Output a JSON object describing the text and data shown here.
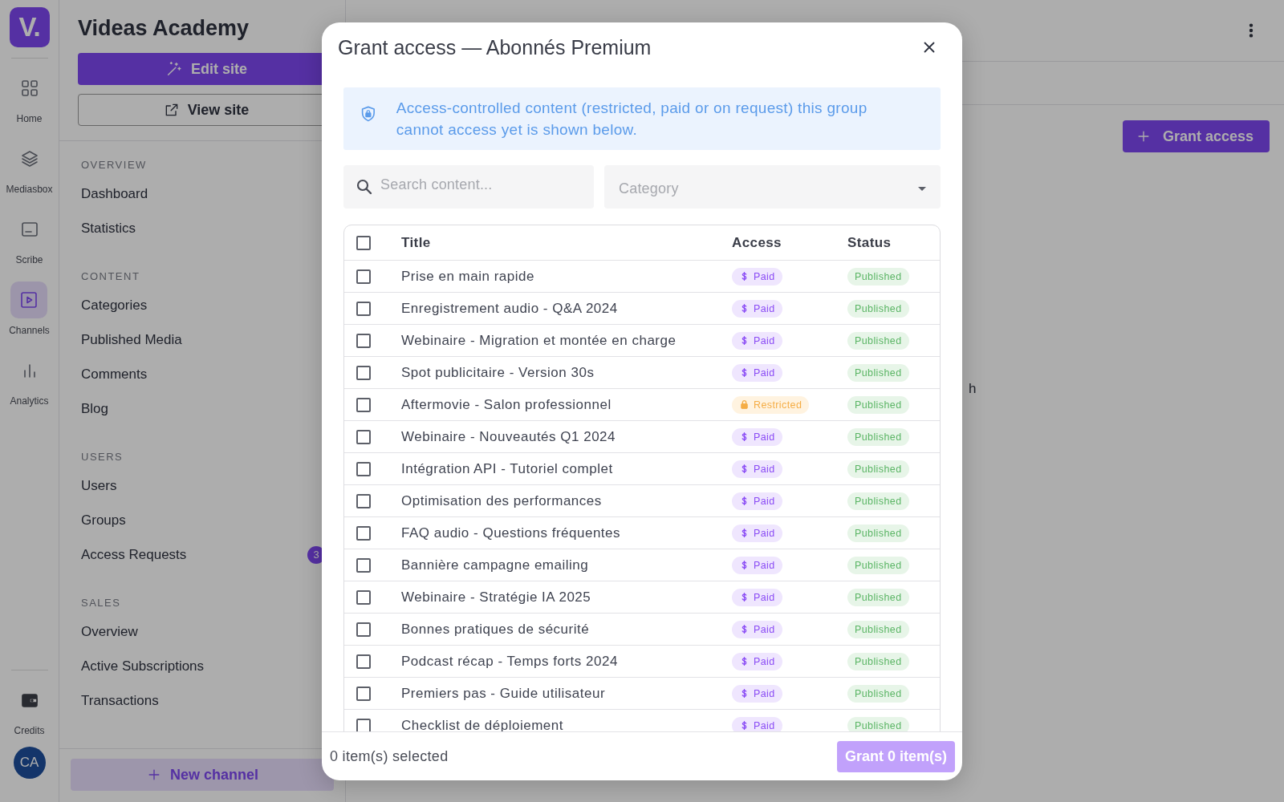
{
  "rail": {
    "logo": "V.",
    "items": [
      {
        "label": "Home",
        "selected": false
      },
      {
        "label": "Mediasbox",
        "selected": false
      },
      {
        "label": "Scribe",
        "selected": false
      },
      {
        "label": "Channels",
        "selected": true
      },
      {
        "label": "Analytics",
        "selected": false
      }
    ],
    "bottom_items": [
      {
        "label": "Credits",
        "selected": false
      }
    ],
    "avatar": "CA"
  },
  "sidebar": {
    "title": "Videas Academy",
    "edit_button": "Edit site",
    "view_button": "View site",
    "sections": [
      {
        "heading": "OVERVIEW",
        "items": [
          {
            "label": "Dashboard"
          },
          {
            "label": "Statistics"
          }
        ]
      },
      {
        "heading": "CONTENT",
        "items": [
          {
            "label": "Categories"
          },
          {
            "label": "Published Media"
          },
          {
            "label": "Comments"
          },
          {
            "label": "Blog"
          }
        ]
      },
      {
        "heading": "USERS",
        "items": [
          {
            "label": "Users"
          },
          {
            "label": "Groups"
          },
          {
            "label": "Access Requests",
            "badge": "3"
          }
        ]
      },
      {
        "heading": "SALES",
        "items": [
          {
            "label": "Overview"
          },
          {
            "label": "Active Subscriptions"
          },
          {
            "label": "Transactions"
          }
        ]
      }
    ],
    "new_channel": "New channel"
  },
  "main": {
    "fragment": "h",
    "grant_button": "Grant access"
  },
  "modal": {
    "title": "Grant access — Abonnés Premium",
    "notice": "Access-controlled content (restricted, paid or on request) this group cannot access yet is shown below.",
    "search": {
      "placeholder": "Search content..."
    },
    "category": {
      "placeholder": "Category"
    },
    "columns": [
      "Title",
      "Access",
      "Status"
    ],
    "all_checked": false,
    "rows": [
      {
        "title": "Prise en main rapide",
        "access": {
          "kind": "paid",
          "label": "Paid"
        },
        "status": {
          "kind": "published",
          "label": "Published"
        },
        "checked": false
      },
      {
        "title": "Enregistrement audio - Q&A 2024",
        "access": {
          "kind": "paid",
          "label": "Paid"
        },
        "status": {
          "kind": "published",
          "label": "Published"
        },
        "checked": false
      },
      {
        "title": "Webinaire - Migration et montée en charge",
        "access": {
          "kind": "paid",
          "label": "Paid"
        },
        "status": {
          "kind": "published",
          "label": "Published"
        },
        "checked": false
      },
      {
        "title": "Spot publicitaire - Version 30s",
        "access": {
          "kind": "paid",
          "label": "Paid"
        },
        "status": {
          "kind": "published",
          "label": "Published"
        },
        "checked": false
      },
      {
        "title": "Aftermovie - Salon professionnel",
        "access": {
          "kind": "restricted",
          "label": "Restricted"
        },
        "status": {
          "kind": "published",
          "label": "Published"
        },
        "checked": false
      },
      {
        "title": "Webinaire - Nouveautés Q1 2024",
        "access": {
          "kind": "paid",
          "label": "Paid"
        },
        "status": {
          "kind": "published",
          "label": "Published"
        },
        "checked": false
      },
      {
        "title": "Intégration API - Tutoriel complet",
        "access": {
          "kind": "paid",
          "label": "Paid"
        },
        "status": {
          "kind": "published",
          "label": "Published"
        },
        "checked": false
      },
      {
        "title": "Optimisation des performances",
        "access": {
          "kind": "paid",
          "label": "Paid"
        },
        "status": {
          "kind": "published",
          "label": "Published"
        },
        "checked": false
      },
      {
        "title": "FAQ audio - Questions fréquentes",
        "access": {
          "kind": "paid",
          "label": "Paid"
        },
        "status": {
          "kind": "published",
          "label": "Published"
        },
        "checked": false
      },
      {
        "title": "Bannière campagne emailing",
        "access": {
          "kind": "paid",
          "label": "Paid"
        },
        "status": {
          "kind": "published",
          "label": "Published"
        },
        "checked": false
      },
      {
        "title": "Webinaire - Stratégie IA 2025",
        "access": {
          "kind": "paid",
          "label": "Paid"
        },
        "status": {
          "kind": "published",
          "label": "Published"
        },
        "checked": false
      },
      {
        "title": "Bonnes pratiques de sécurité",
        "access": {
          "kind": "paid",
          "label": "Paid"
        },
        "status": {
          "kind": "published",
          "label": "Published"
        },
        "checked": false
      },
      {
        "title": "Podcast récap - Temps forts 2024",
        "access": {
          "kind": "paid",
          "label": "Paid"
        },
        "status": {
          "kind": "published",
          "label": "Published"
        },
        "checked": false
      },
      {
        "title": "Premiers pas - Guide utilisateur",
        "access": {
          "kind": "paid",
          "label": "Paid"
        },
        "status": {
          "kind": "published",
          "label": "Published"
        },
        "checked": false
      },
      {
        "title": "Checklist de déploiement",
        "access": {
          "kind": "paid",
          "label": "Paid"
        },
        "status": {
          "kind": "published",
          "label": "Published"
        },
        "checked": false
      }
    ],
    "footer": {
      "selected_text": "0 item(s) selected",
      "grant_button": {
        "label": "Grant 0 item(s)",
        "disabled": true
      }
    }
  }
}
